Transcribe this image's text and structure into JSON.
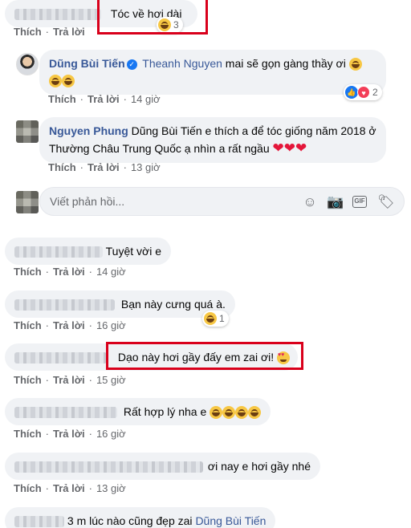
{
  "comment_top": {
    "text": "Tóc về hơi dài",
    "reaction_count": "3",
    "like": "Thích",
    "reply": "Trả lời"
  },
  "reply_dung": {
    "name": "Dũng Bùi Tiến",
    "mention": "Theanh Nguyen",
    "text": "mai sẽ gọn gàng thầy ơi",
    "reaction_count": "2",
    "like": "Thích",
    "reply": "Trả lời",
    "time": "14 giờ"
  },
  "reply_nguyen": {
    "name": "Nguyen Phung",
    "text": "Dũng Bùi Tiến e thích a để tóc giống năm 2018 ở Thường Châu Trung Quốc ạ nhìn a rất ngầu",
    "like": "Thích",
    "reply": "Trả lời",
    "time": "13 giờ"
  },
  "reply_box": {
    "placeholder": "Viết phản hồi...",
    "gif_label": "GIF"
  },
  "comments": [
    {
      "text": "Tuyệt vời e",
      "like": "Thích",
      "reply": "Trả lời",
      "time": "14 giờ"
    },
    {
      "text": "Bạn này cưng quá à.",
      "reaction_count": "1",
      "like": "Thích",
      "reply": "Trả lời",
      "time": "16 giờ"
    },
    {
      "text": "Dạo này hơi gầy đấy em zai ơi!",
      "like": "Thích",
      "reply": "Trả lời",
      "time": "15 giờ"
    },
    {
      "text": "Rất hợp lý nha e",
      "like": "Thích",
      "reply": "Trả lời",
      "time": "16 giờ"
    },
    {
      "text": "ơi nay e hơi gầy nhé",
      "like": "Thích",
      "reply": "Trả lời",
      "time": "13 giờ"
    },
    {
      "text": "3 m lúc nào cũng đẹp zai",
      "mention": "Dũng Bùi Tiến"
    }
  ],
  "colors": {
    "highlight": "#d9001b",
    "bubble": "#f0f2f5",
    "link": "#385898",
    "meta": "#65676b"
  }
}
